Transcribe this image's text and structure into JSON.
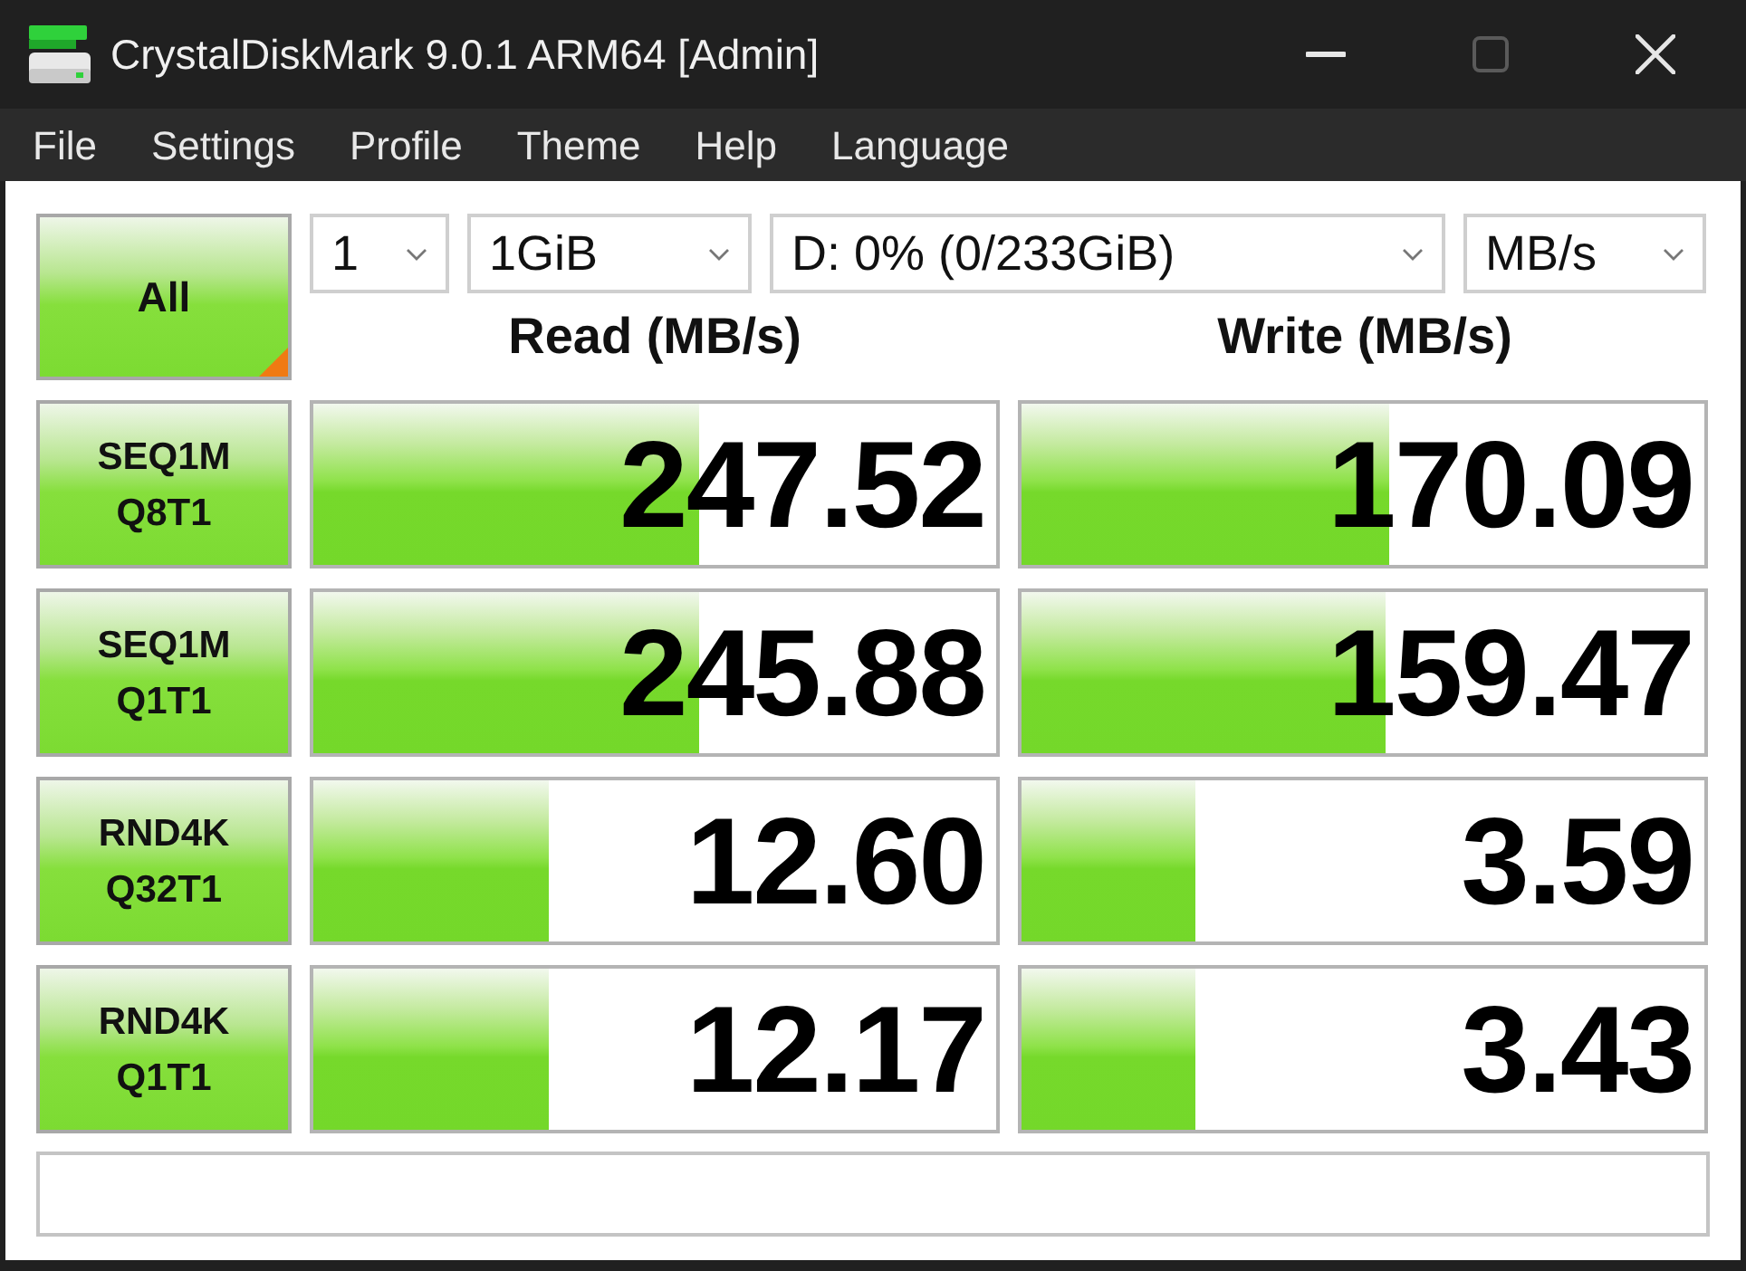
{
  "window": {
    "title": "CrystalDiskMark 9.0.1 ARM64 [Admin]",
    "controls": [
      {
        "kind": "minimize",
        "disabled": false
      },
      {
        "kind": "maximize",
        "disabled": true
      },
      {
        "kind": "close",
        "disabled": false
      }
    ]
  },
  "menu": [
    {
      "label": "File"
    },
    {
      "label": "Settings"
    },
    {
      "label": "Profile"
    },
    {
      "label": "Theme"
    },
    {
      "label": "Help"
    },
    {
      "label": "Language"
    }
  ],
  "all_button": {
    "label": "All"
  },
  "settings": [
    {
      "value": "1"
    },
    {
      "value": "1GiB"
    },
    {
      "value": "D: 0% (0/233GiB)"
    },
    {
      "value": "MB/s"
    }
  ],
  "columns": [
    "Read (MB/s)",
    "Write (MB/s)"
  ],
  "tests": [
    {
      "label": [
        "SEQ1M",
        "Q8T1"
      ],
      "read": {
        "value": "247.52",
        "level": 0.564
      },
      "write": {
        "value": "170.09",
        "level": 0.538
      }
    },
    {
      "label": [
        "SEQ1M",
        "Q1T1"
      ],
      "read": {
        "value": "245.88",
        "level": 0.564
      },
      "write": {
        "value": "159.47",
        "level": 0.533
      }
    },
    {
      "label": [
        "RND4K",
        "Q32T1"
      ],
      "read": {
        "value": "12.60",
        "level": 0.346
      },
      "write": {
        "value": "3.59",
        "level": 0.255
      }
    },
    {
      "label": [
        "RND4K",
        "Q1T1"
      ],
      "read": {
        "value": "12.17",
        "level": 0.346
      },
      "write": {
        "value": "3.43",
        "level": 0.255
      }
    }
  ]
}
